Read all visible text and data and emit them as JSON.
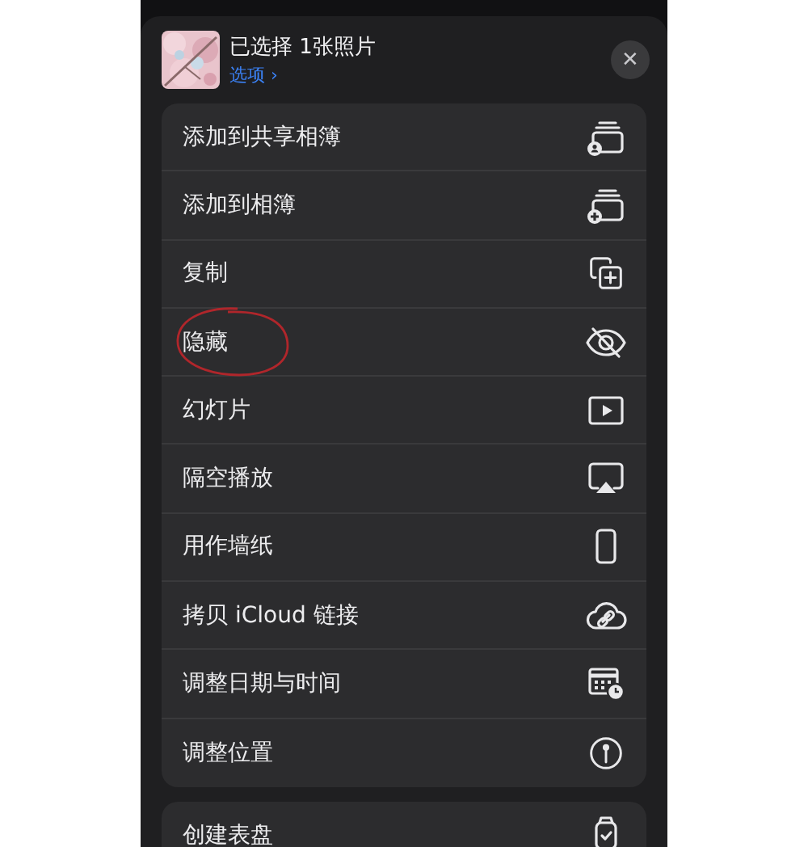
{
  "header": {
    "title": "已选择 1张照片",
    "options_link": "选项",
    "options_chevron": "›",
    "close": "✕"
  },
  "actions": [
    {
      "label": "添加到共享相簿",
      "circled": false
    },
    {
      "label": "添加到相簿",
      "circled": false
    },
    {
      "label": "复制",
      "circled": false
    },
    {
      "label": "隐藏",
      "circled": true
    },
    {
      "label": "幻灯片",
      "circled": false
    },
    {
      "label": "隔空播放",
      "circled": false
    },
    {
      "label": "用作墙纸",
      "circled": false
    },
    {
      "label": "拷贝 iCloud 链接",
      "circled": false
    },
    {
      "label": "调整日期与时间",
      "circled": false
    },
    {
      "label": "调整位置",
      "circled": false
    }
  ],
  "more_actions": [
    {
      "label": "创建表盘",
      "circled": false
    }
  ]
}
